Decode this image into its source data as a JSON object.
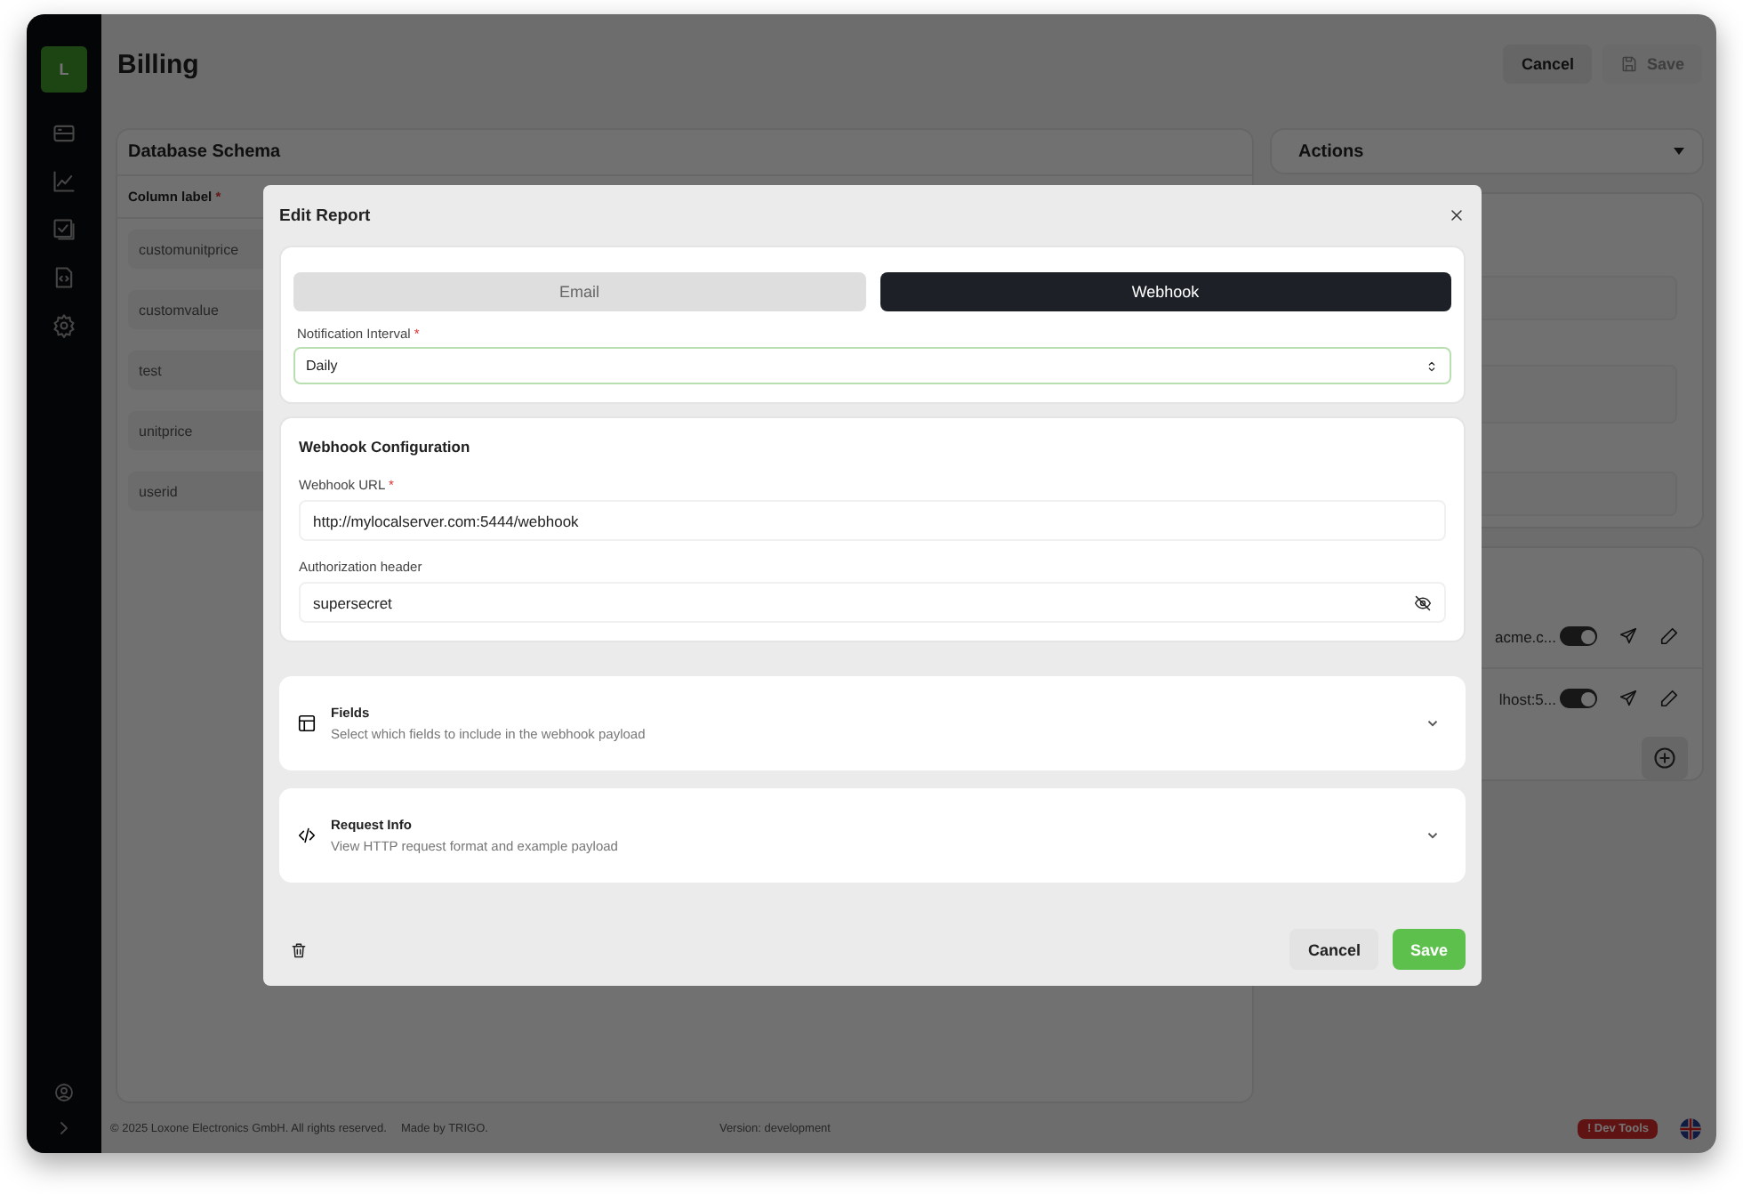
{
  "sidebar": {
    "logo": "L"
  },
  "header": {
    "title": "Billing",
    "buttons": [
      {
        "label": "Cancel",
        "kind": "secondary"
      },
      {
        "label": "Save",
        "kind": "disabled-save"
      }
    ]
  },
  "schema": {
    "title": "Database Schema",
    "column_label": "Column label",
    "mark": "*",
    "rows": [
      "customunitprice",
      "customvalue",
      "test",
      "unitprice",
      "userid"
    ]
  },
  "actions": {
    "title": "Actions",
    "reports": [
      {
        "target": "acme.c...",
        "enabled": true
      },
      {
        "target": "lhost:5...",
        "enabled": true
      }
    ]
  },
  "footer": {
    "copyright": "© 2025 Loxone Electronics GmbH. All rights reserved.",
    "credit": "Made by TRIGO.",
    "version": "Version: development",
    "dev_tools": "! Dev Tools"
  },
  "modal": {
    "title": "Edit Report",
    "tabs": [
      {
        "label": "Email",
        "selected": false
      },
      {
        "label": "Webhook",
        "selected": true
      }
    ],
    "interval": {
      "label": "Notification Interval",
      "mark": "*",
      "value": "Daily"
    },
    "webhook": {
      "title": "Webhook Configuration",
      "url": {
        "label": "Webhook URL",
        "mark": "*",
        "value": "http://mylocalserver.com:5444/webhook"
      },
      "auth": {
        "label": "Authorization header",
        "value": "supersecret"
      }
    },
    "sections": [
      {
        "kind": "table",
        "title": "Fields",
        "subtitle": "Select which fields to include in the webhook payload",
        "expanded": false
      },
      {
        "kind": "code",
        "title": "Request Info",
        "subtitle": "View HTTP request format and example payload",
        "expanded": false
      }
    ],
    "buttons": [
      {
        "label": "Cancel",
        "kind": "secondary"
      },
      {
        "label": "Save",
        "kind": "primary"
      }
    ]
  }
}
